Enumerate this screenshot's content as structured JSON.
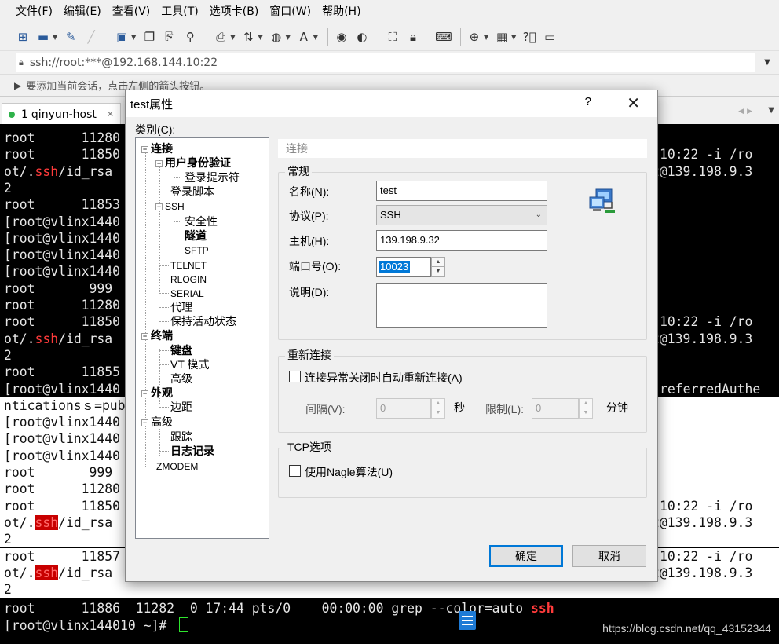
{
  "menubar": [
    "文件(F)",
    "编辑(E)",
    "查看(V)",
    "工具(T)",
    "选项卡(B)",
    "窗口(W)",
    "帮助(H)"
  ],
  "address": {
    "text": "ssh://root:***@192.168.144.10:22"
  },
  "hint": {
    "text": "要添加当前会话，点击左侧的箭头按钮。"
  },
  "tabs": [
    {
      "number": "1",
      "label": "qinyun-host",
      "status_color": "#2fb24a"
    }
  ],
  "terminal": {
    "lines": [
      "root      11280",
      "root      11850",
      "ot/.ssh/id_rsa",
      "2",
      "root      11853",
      "[root@vlinx1440",
      "[root@vlinx1440",
      "[root@vlinx1440",
      "[root@vlinx1440",
      "root       999",
      "root      11280",
      "root      11850",
      "ot/.ssh/id_rsa",
      "2",
      "root      11855",
      "[root@vlinx1440",
      "nticationsｓ=publ",
      "[root@vlinx1440",
      "[root@vlinx1440",
      "[root@vlinx1440",
      "root       999",
      "root      11280",
      "root      11850",
      "ot/.ssh/id_rsa",
      "2",
      "root      11857",
      "ot/.ssh/id_rsa",
      "2"
    ],
    "right_lines": [
      {
        "row": 1,
        "text": "10:22 -i /ro"
      },
      {
        "row": 2,
        "text": "t@139.198.9.3"
      },
      {
        "row": 11,
        "text": "10:22 -i /ro"
      },
      {
        "row": 12,
        "text": "t@139.198.9.3"
      },
      {
        "row": 15,
        "text": "referredAuthe"
      },
      {
        "row": 22,
        "text": "10:22 -i /ro"
      },
      {
        "row": 23,
        "text": "t@139.198.9.3"
      },
      {
        "row": 25,
        "text": "10:22 -i /ro"
      },
      {
        "row": 26,
        "text": "t@139.198.9.3"
      }
    ],
    "bottom_line": {
      "pre": "root      11886  11282  0 17:44 pts/0    00:00:00 grep --color=auto ",
      "hl": "ssh"
    },
    "prompt": "[root@vlinx144010 ~]# ",
    "watermark": "https://blog.csdn.net/qq_43152344"
  },
  "dialog": {
    "title": "test属性",
    "help": "?",
    "close": "✕",
    "category_label": "类别(C):",
    "tree": {
      "connect": "连接",
      "auth": "用户身份验证",
      "login_prompt": "登录提示符",
      "login_script": "登录脚本",
      "ssh": "SSH",
      "security": "安全性",
      "tunnel": "隧道",
      "sftp": "SFTP",
      "telnet": "TELNET",
      "rlogin": "RLOGIN",
      "serial": "SERIAL",
      "proxy": "代理",
      "keepalive": "保持活动状态",
      "terminal": "终端",
      "keyboard": "键盘",
      "vt_mode": "VT 模式",
      "advanced": "高级",
      "appearance": "外观",
      "margin": "边距",
      "advanced2": "高级",
      "trace": "跟踪",
      "log": "日志记录",
      "zmodem": "ZMODEM"
    },
    "panel_header": "连接",
    "general": {
      "title": "常规",
      "name_label": "名称(N):",
      "name_value": "test",
      "protocol_label": "协议(P):",
      "protocol_value": "SSH",
      "host_label": "主机(H):",
      "host_value": "139.198.9.32",
      "port_label": "端口号(O):",
      "port_value": "10023",
      "desc_label": "说明(D):",
      "desc_value": ""
    },
    "reconnect": {
      "title": "重新连接",
      "checkbox_label": "连接异常关闭时自动重新连接(A)",
      "interval_label": "间隔(V):",
      "interval_value": "0",
      "interval_unit": "秒",
      "limit_label": "限制(L):",
      "limit_value": "0",
      "limit_unit": "分钟"
    },
    "tcp": {
      "title": "TCP选项",
      "checkbox_label": "使用Nagle算法(U)"
    },
    "ok": "确定",
    "cancel": "取消"
  }
}
